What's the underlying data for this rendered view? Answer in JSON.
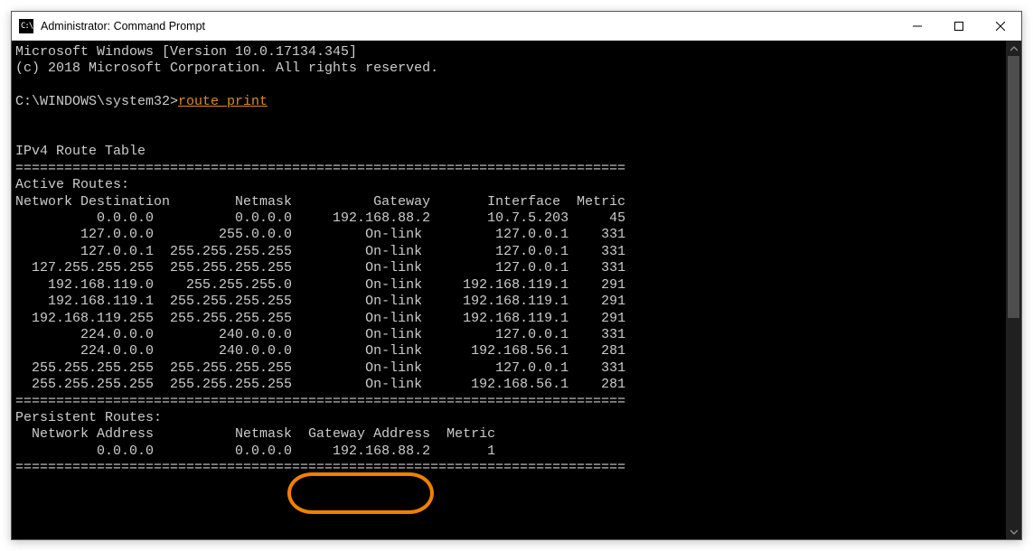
{
  "window": {
    "title": "Administrator: Command Prompt",
    "app_icon_text": "C:\\"
  },
  "term": {
    "banner_line1": "Microsoft Windows [Version 10.0.17134.345]",
    "banner_line2": "(c) 2018 Microsoft Corporation. All rights reserved.",
    "prompt": "C:\\WINDOWS\\system32>",
    "command": "route print",
    "section_title": "IPv4 Route Table",
    "rule": "===========================================================================",
    "active_header": "Active Routes:",
    "columns": "Network Destination        Netmask          Gateway       Interface  Metric",
    "routes": [
      "          0.0.0.0          0.0.0.0     192.168.88.2       10.7.5.203     45",
      "        127.0.0.0        255.0.0.0         On-link         127.0.0.1    331",
      "        127.0.0.1  255.255.255.255         On-link         127.0.0.1    331",
      "  127.255.255.255  255.255.255.255         On-link         127.0.0.1    331",
      "    192.168.119.0    255.255.255.0         On-link     192.168.119.1    291",
      "    192.168.119.1  255.255.255.255         On-link     192.168.119.1    291",
      "  192.168.119.255  255.255.255.255         On-link     192.168.119.1    291",
      "        224.0.0.0        240.0.0.0         On-link         127.0.0.1    331",
      "        224.0.0.0        240.0.0.0         On-link      192.168.56.1    281",
      "  255.255.255.255  255.255.255.255         On-link         127.0.0.1    331",
      "  255.255.255.255  255.255.255.255         On-link      192.168.56.1    281"
    ],
    "persist_header": "Persistent Routes:",
    "persist_columns": "  Network Address          Netmask  Gateway Address  Metric",
    "persist_row": "          0.0.0.0          0.0.0.0     192.168.88.2       1"
  },
  "highlight": {
    "label": "Gateway Address / 192.168.88.2"
  }
}
